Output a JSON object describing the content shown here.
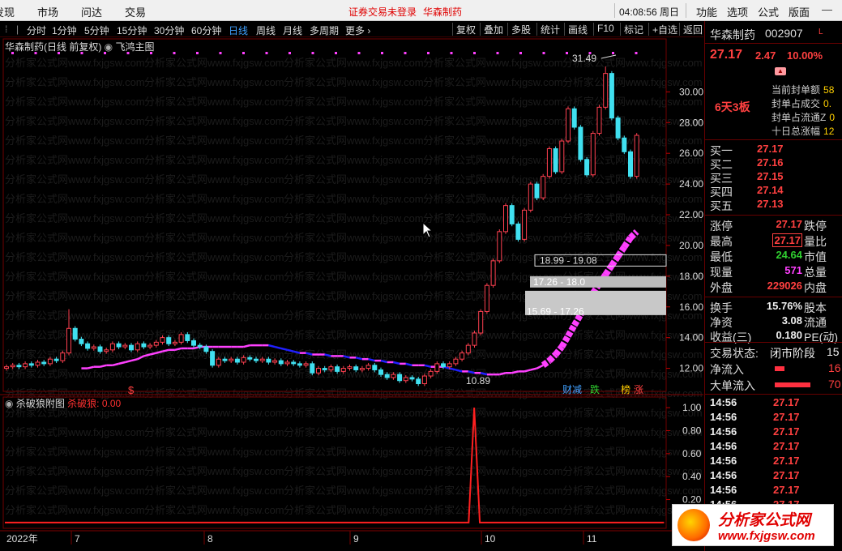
{
  "menu": {
    "items": [
      "发现",
      "市场",
      "问达",
      "交易"
    ],
    "warning": "证券交易未登录",
    "warn_stock": "华森制药",
    "clock": "04:08:56 周日",
    "right_items": [
      "功能",
      "选项",
      "公式",
      "版面"
    ]
  },
  "toolbar": {
    "periods": [
      "分时",
      "1分钟",
      "5分钟",
      "15分钟",
      "30分钟",
      "60分钟",
      "日线",
      "周线",
      "月线",
      "多周期",
      "更多"
    ],
    "active_period": "日线",
    "buttons": [
      "复权",
      "叠加",
      "多股",
      "统计",
      "画线",
      "F10",
      "标记",
      "+自选",
      "返回"
    ]
  },
  "chart": {
    "legend": "华森制药(日线 前复权)",
    "indicator": "飞鸿主图",
    "sub_legend": "杀破狼附图",
    "sub_value": "杀破狼: 0.00",
    "annotations": {
      "high": "31.49",
      "low": "10.89",
      "band1": "18.99 - 19.08",
      "band2": "17.26 - 18.0",
      "band3": "15.69 - 17.26"
    },
    "signals": [
      "$",
      "财",
      "减",
      "跌",
      "榜",
      "涨"
    ],
    "watermark": "分析家公式网www.fxjgsw.com"
  },
  "chart_data": [
    {
      "type": "candlestick",
      "title": "华森制药(日线 前复权)",
      "y_ticks": [
        "30.00",
        "28.00",
        "26.00",
        "24.00",
        "22.00",
        "20.00",
        "18.00",
        "16.00",
        "14.00",
        "12.00"
      ],
      "ylim": [
        10.5,
        32.5
      ],
      "x_ticks": [
        "2022年",
        "7",
        "8",
        "9",
        "10",
        "11"
      ],
      "series": [
        {
          "name": "close",
          "values": [
            12.1,
            12.2,
            12.1,
            12.3,
            12.2,
            12.4,
            12.3,
            12.6,
            12.5,
            13.0,
            14.6,
            13.9,
            13.6,
            13.3,
            13.4,
            13.1,
            13.2,
            13.6,
            13.4,
            13.5,
            13.2,
            13.6,
            13.4,
            13.5,
            13.7,
            14.0,
            13.6,
            13.7,
            14.2,
            13.8,
            13.5,
            13.4,
            13.1,
            12.2,
            12.6,
            12.5,
            12.6,
            12.4,
            12.7,
            12.6,
            12.5,
            12.6,
            12.4,
            12.5,
            12.3,
            12.4,
            12.3,
            12.2,
            12.3,
            11.7,
            12.0,
            11.9,
            12.1,
            11.8,
            12.0,
            12.1,
            11.9,
            12.0,
            12.2,
            11.9,
            11.6,
            11.4,
            11.6,
            11.2,
            11.4,
            11.3,
            11.0,
            11.5,
            11.8,
            12.3,
            12.1,
            12.3,
            12.6,
            13.0,
            13.5,
            14.3,
            15.7,
            17.4,
            19.0,
            20.9,
            22.6,
            21.4,
            20.4,
            22.3,
            24.0,
            23.1,
            24.5,
            26.3,
            24.8,
            26.8,
            28.9,
            27.7,
            25.6,
            24.6,
            27.3,
            29.0,
            31.2,
            28.3,
            27.0,
            26.1,
            24.5,
            27.17
          ]
        },
        {
          "name": "飞鸿",
          "values": [
            12.0,
            12.0,
            12.1,
            12.1,
            12.2,
            12.2,
            12.3,
            12.4,
            12.5,
            12.6,
            12.8,
            12.9,
            13.0,
            13.1,
            13.2,
            13.2,
            13.3,
            13.3,
            13.3,
            13.4,
            13.4,
            13.4,
            13.4,
            13.4,
            13.4,
            13.4,
            13.4,
            13.5,
            13.5,
            13.5,
            13.5,
            13.4,
            13.3,
            13.2,
            13.1,
            13.0,
            13.0,
            12.9,
            12.9,
            12.9,
            12.8,
            12.8,
            12.8,
            12.7,
            12.7,
            12.6,
            12.6,
            12.5,
            12.5,
            12.4,
            12.4,
            12.3,
            12.3,
            12.2,
            12.2,
            12.2,
            12.1,
            12.1,
            12.1,
            12.0,
            11.9,
            11.8,
            11.8,
            11.7,
            11.7,
            11.6,
            11.6,
            11.6,
            11.7,
            11.7,
            11.8,
            11.8,
            11.9,
            12.0,
            12.2,
            12.5,
            12.9,
            13.4,
            14.1,
            14.8,
            15.5,
            16.2,
            16.9,
            17.5,
            18.1,
            18.7,
            19.3,
            19.9,
            20.5,
            20.9
          ]
        }
      ]
    },
    {
      "type": "line",
      "title": "杀破狼附图",
      "y_ticks": [
        "1.00",
        "0.80",
        "0.60",
        "0.40",
        "0.20"
      ],
      "ylim": [
        -0.05,
        1.05
      ],
      "series": [
        {
          "name": "杀破狼",
          "x": [
            0,
            584,
            591,
            598,
            830
          ],
          "values": [
            0,
            0,
            1.0,
            0,
            0
          ]
        }
      ]
    }
  ],
  "quote": {
    "name": "华森制药",
    "code": "002907",
    "mark": "L",
    "price": "27.17",
    "change": "2.47",
    "pct": "10.00%",
    "board": "6天3板",
    "seal": [
      {
        "label": "当前封单额",
        "value": "58"
      },
      {
        "label": "封单占成交",
        "value": "0."
      },
      {
        "label": "封单占流通Z",
        "value": "0"
      },
      {
        "label": "十日总涨幅",
        "value": "12"
      }
    ],
    "bids": [
      {
        "label": "买一",
        "value": "27.17"
      },
      {
        "label": "买二",
        "value": "27.16"
      },
      {
        "label": "买三",
        "value": "27.15"
      },
      {
        "label": "买四",
        "value": "27.14"
      },
      {
        "label": "买五",
        "value": "27.13"
      }
    ],
    "stats": [
      {
        "label": "涨停",
        "value": "27.17",
        "label2": "跌停",
        "color": "red"
      },
      {
        "label": "最高",
        "value": "27.17",
        "label2": "量比",
        "color": "red"
      },
      {
        "label": "最低",
        "value": "24.64",
        "label2": "市值",
        "color": "green"
      },
      {
        "label": "现量",
        "value": "571",
        "label2": "总量",
        "color": "mag"
      },
      {
        "label": "外盘",
        "value": "229026",
        "label2": "内盘",
        "color": "red"
      }
    ],
    "stats2": [
      {
        "label": "换手",
        "value": "15.76%",
        "label2": "股本"
      },
      {
        "label": "净资",
        "value": "3.08",
        "label2": "流通"
      },
      {
        "label": "收益(三)",
        "value": "0.180",
        "label2": "PE(动)"
      }
    ],
    "trade_state_label": "交易状态:",
    "trade_state": "闭市阶段",
    "trade_state_tail": "15",
    "netflow_label": "净流入",
    "netflow_tail": "16",
    "bigflow_label": "大单流入",
    "bigflow_tail": "70",
    "ticks": [
      {
        "time": "14:56",
        "price": "27.17"
      },
      {
        "time": "14:56",
        "price": "27.17"
      },
      {
        "time": "14:56",
        "price": "27.17"
      },
      {
        "time": "14:56",
        "price": "27.17"
      },
      {
        "time": "14:56",
        "price": "27.17"
      },
      {
        "time": "14:56",
        "price": "27.17"
      },
      {
        "time": "14:56",
        "price": "27.17"
      },
      {
        "time": "14:56",
        "price": "27.17"
      }
    ]
  },
  "logo": {
    "title": "分析家公式网",
    "url": "www.fxjgsw.com"
  }
}
